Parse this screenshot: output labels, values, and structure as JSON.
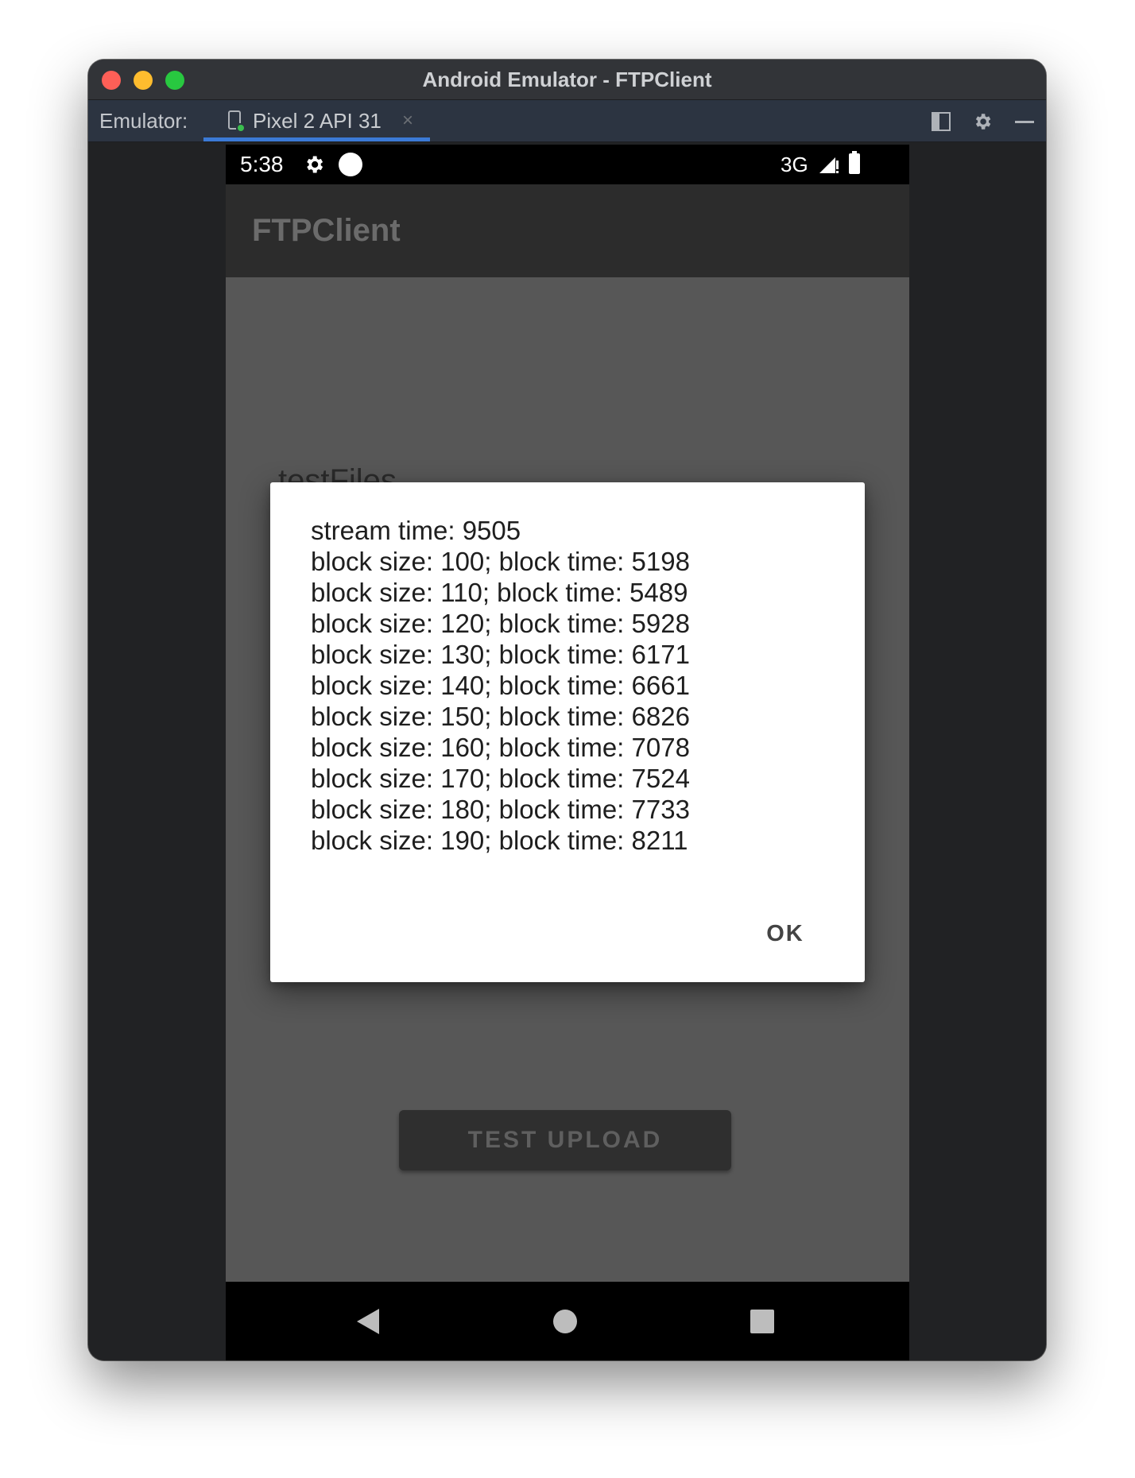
{
  "window": {
    "title": "Android Emulator - FTPClient"
  },
  "toolbar": {
    "label": "Emulator:",
    "device_tab": "Pixel 2 API 31",
    "tab_close": "×",
    "icons": [
      "window-layout-icon",
      "gear-icon",
      "minimize-icon"
    ]
  },
  "status_bar": {
    "time": "5:38",
    "network": "3G"
  },
  "app": {
    "title": "FTPClient",
    "file_label": "testFiles",
    "upload_button": "TEST UPLOAD"
  },
  "dialog": {
    "lines": [
      "stream time: 9505",
      "block size: 100; block time: 5198",
      "block size: 110; block time: 5489",
      "block size: 120; block time: 5928",
      "block size: 130; block time: 6171",
      "block size: 140; block time: 6661",
      "block size: 150; block time: 6826",
      "block size: 160; block time: 7078",
      "block size: 170; block time: 7524",
      "block size: 180; block time: 7733",
      "block size: 190; block time: 8211"
    ],
    "ok_label": "OK"
  },
  "colors": {
    "accent_tab_underline": "#3b7ad6",
    "dialog_background": "#ffffff",
    "scrim": "#575757"
  }
}
